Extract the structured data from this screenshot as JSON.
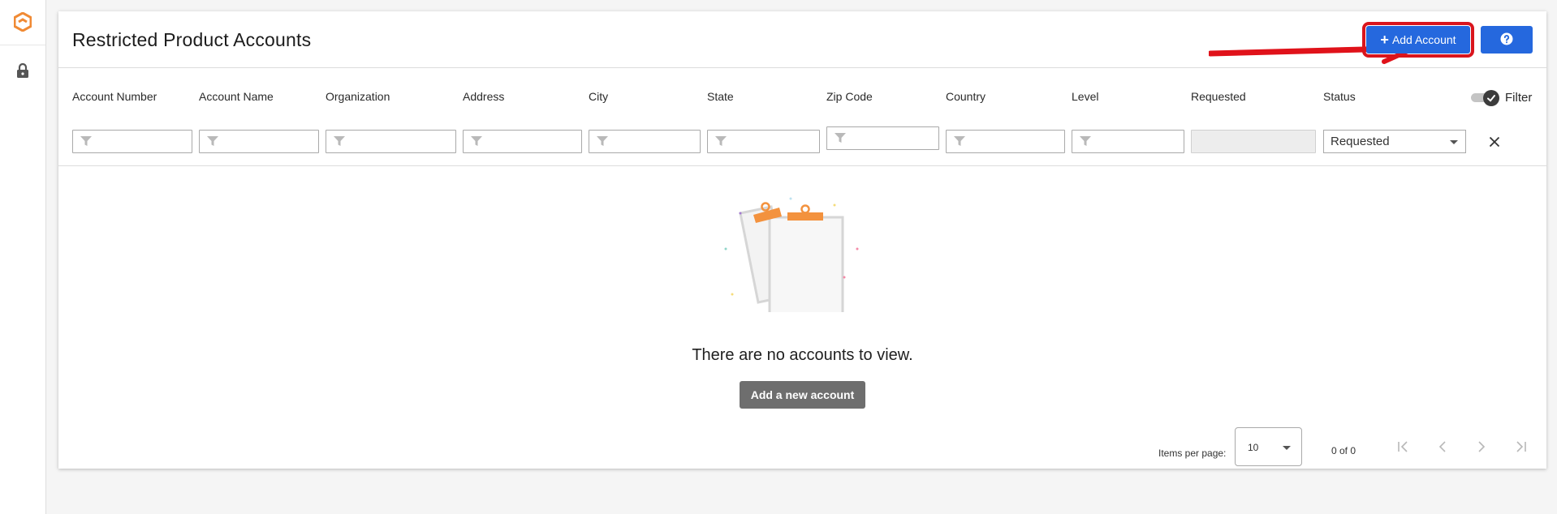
{
  "page": {
    "title": "Restricted Product Accounts"
  },
  "header": {
    "add_button_label": "Add Account",
    "add_button_icon": "plus-icon",
    "help_button_icon": "help-icon"
  },
  "columns": [
    {
      "key": "account_number",
      "label": "Account Number"
    },
    {
      "key": "account_name",
      "label": "Account Name"
    },
    {
      "key": "organization",
      "label": "Organization"
    },
    {
      "key": "address",
      "label": "Address"
    },
    {
      "key": "city",
      "label": "City"
    },
    {
      "key": "state",
      "label": "State"
    },
    {
      "key": "zip_code",
      "label": "Zip Code"
    },
    {
      "key": "country",
      "label": "Country"
    },
    {
      "key": "level",
      "label": "Level"
    },
    {
      "key": "requested",
      "label": "Requested"
    },
    {
      "key": "status",
      "label": "Status"
    }
  ],
  "filters": {
    "toggle_label": "Filter",
    "toggle_on": true,
    "status_value": "Requested"
  },
  "empty_state": {
    "message": "There are no accounts to view.",
    "button_label": "Add a new account"
  },
  "paginator": {
    "items_per_page_label": "Items per page:",
    "items_per_page_value": "10",
    "range_label": "0 of 0"
  },
  "colors": {
    "primary": "#2568de",
    "highlight": "#d9151d",
    "logo": "#f08a34"
  }
}
